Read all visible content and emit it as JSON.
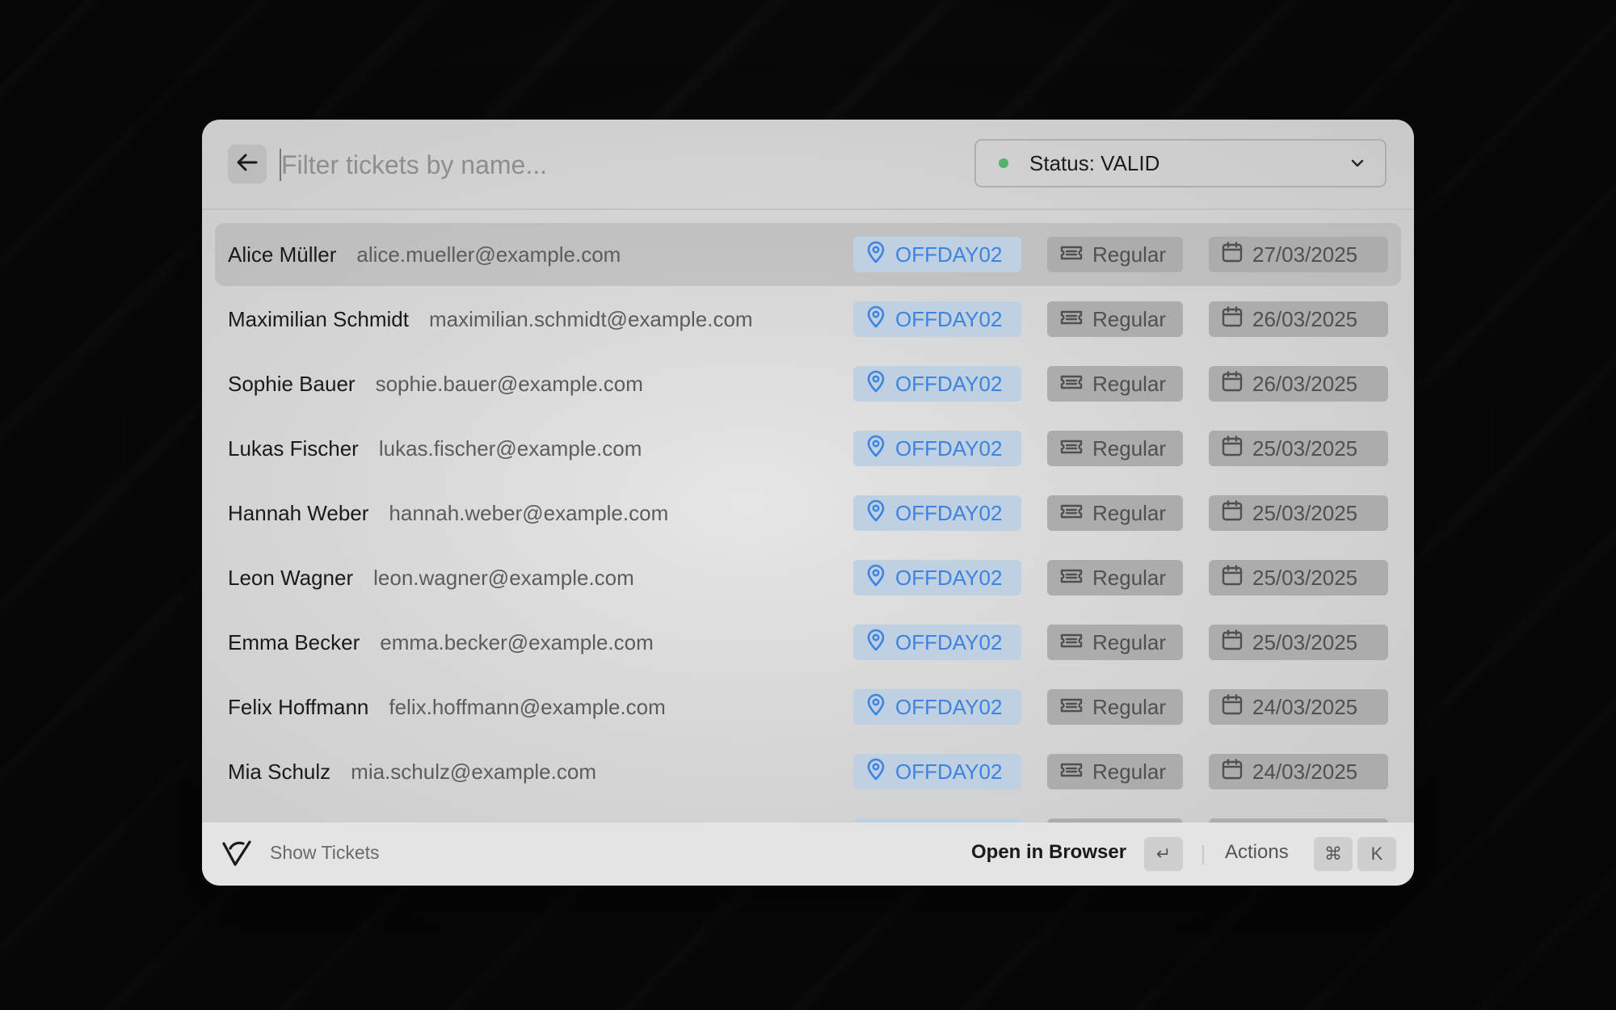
{
  "search": {
    "placeholder": "Filter tickets by name..."
  },
  "status_filter": {
    "label": "Status: VALID",
    "dot_color": "#52b36a"
  },
  "colors": {
    "location_tag_bg": "#c0d0e3",
    "location_tag_text": "#3d83e0",
    "neutral_tag_bg": "#acacac"
  },
  "tickets": [
    {
      "name": "Alice Müller",
      "email": "alice.mueller@example.com",
      "location": "OFFDAY02",
      "type": "Regular",
      "date": "27/03/2025"
    },
    {
      "name": "Maximilian Schmidt",
      "email": "maximilian.schmidt@example.com",
      "location": "OFFDAY02",
      "type": "Regular",
      "date": "26/03/2025"
    },
    {
      "name": "Sophie Bauer",
      "email": "sophie.bauer@example.com",
      "location": "OFFDAY02",
      "type": "Regular",
      "date": "26/03/2025"
    },
    {
      "name": "Lukas Fischer",
      "email": "lukas.fischer@example.com",
      "location": "OFFDAY02",
      "type": "Regular",
      "date": "25/03/2025"
    },
    {
      "name": "Hannah Weber",
      "email": "hannah.weber@example.com",
      "location": "OFFDAY02",
      "type": "Regular",
      "date": "25/03/2025"
    },
    {
      "name": "Leon Wagner",
      "email": "leon.wagner@example.com",
      "location": "OFFDAY02",
      "type": "Regular",
      "date": "25/03/2025"
    },
    {
      "name": "Emma Becker",
      "email": "emma.becker@example.com",
      "location": "OFFDAY02",
      "type": "Regular",
      "date": "25/03/2025"
    },
    {
      "name": "Felix Hoffmann",
      "email": "felix.hoffmann@example.com",
      "location": "OFFDAY02",
      "type": "Regular",
      "date": "24/03/2025"
    },
    {
      "name": "Mia Schulz",
      "email": "mia.schulz@example.com",
      "location": "OFFDAY02",
      "type": "Regular",
      "date": "24/03/2025"
    }
  ],
  "footer": {
    "title": "Show Tickets",
    "primary_action": "Open in Browser",
    "primary_key": "↵",
    "actions_label": "Actions",
    "actions_keys": [
      "⌘",
      "K"
    ]
  }
}
